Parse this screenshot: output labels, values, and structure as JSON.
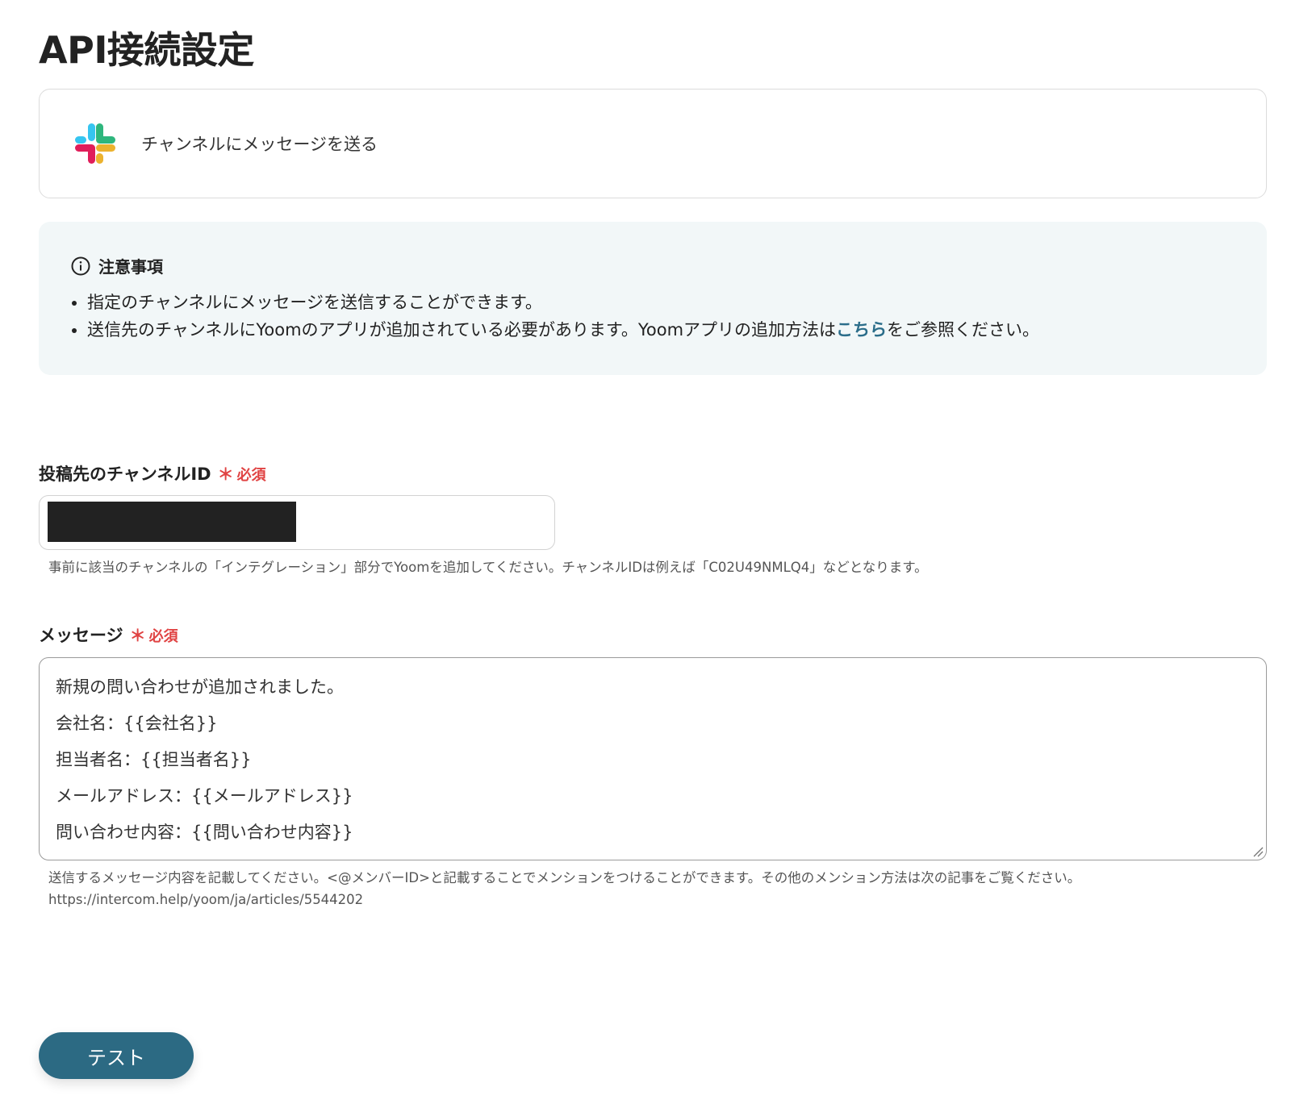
{
  "page_title": "API接続設定",
  "action": {
    "app_icon": "slack-icon",
    "label": "チャンネルにメッセージを送る"
  },
  "notice": {
    "icon": "info-icon",
    "heading": "注意事項",
    "items": [
      "指定のチャンネルにメッセージを送信することができます。"
    ],
    "item2_before": "送信先のチャンネルにYoomのアプリが追加されている必要があります。Yoomアプリの追加方法は",
    "item2_link": "こちら",
    "item2_after": "をご参照ください。"
  },
  "channel_field": {
    "label": "投稿先のチャンネルID",
    "required_star": "＊",
    "required_text": "必須",
    "help": "事前に該当のチャンネルの「インテグレーション」部分でYoomを追加してください。チャンネルIDは例えば「C02U49NMLQ4」などとなります。"
  },
  "message_field": {
    "label": "メッセージ",
    "required_star": "＊",
    "required_text": "必須",
    "lines": [
      "新規の問い合わせが追加されました。",
      "会社名：{{会社名}}",
      "担当者名：{{担当者名}}",
      "メールアドレス：{{メールアドレス}}",
      "問い合わせ内容：{{問い合わせ内容}}"
    ],
    "help_line1": "送信するメッセージ内容を記載してください。<@メンバーID>と記載することでメンションをつけることができます。その他のメンション方法は次の記事をご覧ください。",
    "help_line2": "https://intercom.help/yoom/ja/articles/5544202"
  },
  "test_button_label": "テスト",
  "colors": {
    "accent": "#2c6a83",
    "required": "#e04343",
    "link": "#2b6d8a",
    "notice_bg": "#f2f7f8"
  }
}
